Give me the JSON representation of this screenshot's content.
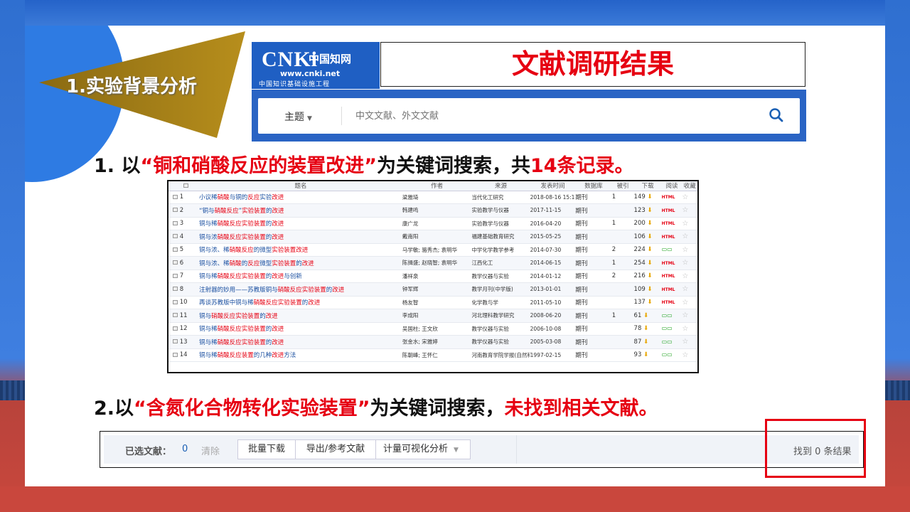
{
  "section_title": "1.实验背景分析",
  "cnki": {
    "brand": "CNKi",
    "brand_cn": "中国知网",
    "url": "www.cnki.net",
    "tagline": "中国知识基础设施工程"
  },
  "banner_title": "文献调研结果",
  "search": {
    "scope_label": "主题",
    "placeholder": "中文文献、外文文献"
  },
  "line1": {
    "prefix": "1. 以",
    "keyword": "“铜和硝酸反应的装置改进”",
    "middle": "为关键词搜索，共",
    "count": "14条记录。"
  },
  "line2": {
    "prefix": "2.以",
    "keyword": "“含氮化合物转化实验装置”",
    "middle": "为关键词搜索，",
    "result": "未找到相关文献。"
  },
  "table": {
    "headers": [
      "题名",
      "作者",
      "来源",
      "发表时间",
      "数据库",
      "被引",
      "下载",
      "阅读",
      "收藏"
    ],
    "rows": [
      {
        "n": "1",
        "title": "小议稀硝酸与铜的反应实验改进",
        "author": "梁雅琦",
        "source": "当代化工研究",
        "date": "2018-08-16 15:16",
        "db": "期刊",
        "cited": "1",
        "dl": "149",
        "read": "HTML"
      },
      {
        "n": "2",
        "title": "“铜与硝酸反应”实验装置的改进",
        "author": "韩建鸣",
        "source": "实验教学与仪器",
        "date": "2017-11-15",
        "db": "期刊",
        "cited": "",
        "dl": "123",
        "read": "HTML"
      },
      {
        "n": "3",
        "title": "铜与稀硝酸反应实验装置的改进",
        "author": "康广龙",
        "source": "实验教学与仪器",
        "date": "2016-04-20",
        "db": "期刊",
        "cited": "1",
        "dl": "200",
        "read": "HTML"
      },
      {
        "n": "4",
        "title": "铜与浓硝酸反应实验装置的改进",
        "author": "戴南阳",
        "source": "福建基础教育研究",
        "date": "2015-05-25",
        "db": "期刊",
        "cited": "",
        "dl": "106",
        "read": "HTML"
      },
      {
        "n": "5",
        "title": "铜与浓、稀硝酸反应的微型实验装置改进",
        "author": "马学敏; 骆秀杰; 袁明华",
        "source": "中学化学教学参考",
        "date": "2014-07-30",
        "db": "期刊",
        "cited": "2",
        "dl": "224",
        "read": "BOOK"
      },
      {
        "n": "6",
        "title": "铜与浓、稀硝酸的反应微型实验装置的改进",
        "author": "陈揖盛; 赵晓智; 袁明华",
        "source": "江西化工",
        "date": "2014-06-15",
        "db": "期刊",
        "cited": "1",
        "dl": "254",
        "read": "HTML"
      },
      {
        "n": "7",
        "title": "铜与稀硝酸反应实验装置的改进与创新",
        "author": "潘祥泉",
        "source": "教学仪器与实验",
        "date": "2014-01-12",
        "db": "期刊",
        "cited": "2",
        "dl": "216",
        "read": "HTML"
      },
      {
        "n": "8",
        "title": "注射器的妙用——苏教版铜与硝酸反应实验装置的改进",
        "author": "钟军辉",
        "source": "教学月刊(中学版)",
        "date": "2013-01-01",
        "db": "期刊",
        "cited": "",
        "dl": "109",
        "read": "HTML"
      },
      {
        "n": "10",
        "title": "再谈苏教版中铜与稀硝酸反应实验装置的改进",
        "author": "杨友智",
        "source": "化学教与学",
        "date": "2011-05-10",
        "db": "期刊",
        "cited": "",
        "dl": "137",
        "read": "HTML"
      },
      {
        "n": "11",
        "title": "铜与硝酸反应实验装置的改进",
        "author": "李成阳",
        "source": "河北理科教学研究",
        "date": "2008-06-20",
        "db": "期刊",
        "cited": "1",
        "dl": "61",
        "read": "BOOK"
      },
      {
        "n": "12",
        "title": "铜与稀硝酸反应实验装置的改进",
        "author": "吴国柱; 王文欣",
        "source": "教学仪器与实验",
        "date": "2006-10-08",
        "db": "期刊",
        "cited": "",
        "dl": "78",
        "read": "BOOK"
      },
      {
        "n": "13",
        "title": "铜与稀硝酸反应实验装置的改进",
        "author": "张金水; 宋雅婷",
        "source": "教学仪器与实验",
        "date": "2005-03-08",
        "db": "期刊",
        "cited": "",
        "dl": "87",
        "read": "BOOK"
      },
      {
        "n": "14",
        "title": "铜与稀硝酸反应装置的几种改进方法",
        "author": "陈朝峰; 王怀仁",
        "source": "河南教育学院学报(自然科学版)",
        "date": "1997-02-15",
        "db": "期刊",
        "cited": "",
        "dl": "93",
        "read": "BOOK"
      }
    ]
  },
  "toolbar": {
    "selected_label": "已选文献：",
    "selected_count": "0",
    "clear": "清除",
    "batch_download": "批量下载",
    "export": "导出/参考文献",
    "visual": "计量可视化分析",
    "found": "找到 0 条结果"
  },
  "colors": {
    "accent_red": "#e60012",
    "cnki_blue": "#1f5fc3",
    "frame_blue": "#2f6fd0"
  }
}
